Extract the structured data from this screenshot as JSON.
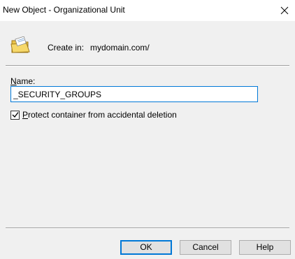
{
  "window": {
    "title": "New Object - Organizational Unit",
    "close_icon": "close-icon"
  },
  "header": {
    "icon": "organizational-unit-folder-icon",
    "create_in_label": "Create in:",
    "create_in_value": "mydomain.com/"
  },
  "form": {
    "name_label_mnemonic": "N",
    "name_label_rest": "ame:",
    "name_value": "_SECURITY_GROUPS",
    "protect_checked": true,
    "protect_label_mnemonic": "P",
    "protect_label_rest": "rotect container from accidental deletion"
  },
  "buttons": {
    "ok": "OK",
    "cancel": "Cancel",
    "help": "Help"
  }
}
